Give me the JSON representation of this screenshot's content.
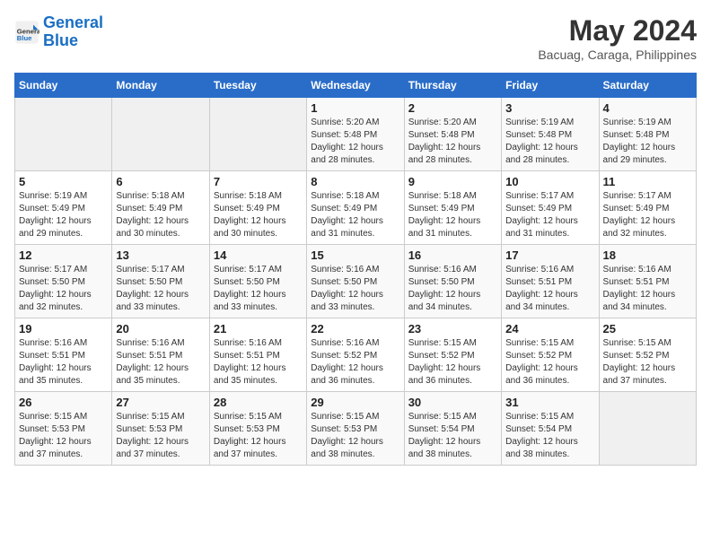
{
  "header": {
    "logo_line1": "General",
    "logo_line2": "Blue",
    "month": "May 2024",
    "location": "Bacuag, Caraga, Philippines"
  },
  "weekdays": [
    "Sunday",
    "Monday",
    "Tuesday",
    "Wednesday",
    "Thursday",
    "Friday",
    "Saturday"
  ],
  "weeks": [
    [
      {
        "day": "",
        "sunrise": "",
        "sunset": "",
        "daylight": ""
      },
      {
        "day": "",
        "sunrise": "",
        "sunset": "",
        "daylight": ""
      },
      {
        "day": "",
        "sunrise": "",
        "sunset": "",
        "daylight": ""
      },
      {
        "day": "1",
        "sunrise": "5:20 AM",
        "sunset": "5:48 PM",
        "daylight": "12 hours and 28 minutes."
      },
      {
        "day": "2",
        "sunrise": "5:20 AM",
        "sunset": "5:48 PM",
        "daylight": "12 hours and 28 minutes."
      },
      {
        "day": "3",
        "sunrise": "5:19 AM",
        "sunset": "5:48 PM",
        "daylight": "12 hours and 28 minutes."
      },
      {
        "day": "4",
        "sunrise": "5:19 AM",
        "sunset": "5:48 PM",
        "daylight": "12 hours and 29 minutes."
      }
    ],
    [
      {
        "day": "5",
        "sunrise": "5:19 AM",
        "sunset": "5:49 PM",
        "daylight": "12 hours and 29 minutes."
      },
      {
        "day": "6",
        "sunrise": "5:18 AM",
        "sunset": "5:49 PM",
        "daylight": "12 hours and 30 minutes."
      },
      {
        "day": "7",
        "sunrise": "5:18 AM",
        "sunset": "5:49 PM",
        "daylight": "12 hours and 30 minutes."
      },
      {
        "day": "8",
        "sunrise": "5:18 AM",
        "sunset": "5:49 PM",
        "daylight": "12 hours and 31 minutes."
      },
      {
        "day": "9",
        "sunrise": "5:18 AM",
        "sunset": "5:49 PM",
        "daylight": "12 hours and 31 minutes."
      },
      {
        "day": "10",
        "sunrise": "5:17 AM",
        "sunset": "5:49 PM",
        "daylight": "12 hours and 31 minutes."
      },
      {
        "day": "11",
        "sunrise": "5:17 AM",
        "sunset": "5:49 PM",
        "daylight": "12 hours and 32 minutes."
      }
    ],
    [
      {
        "day": "12",
        "sunrise": "5:17 AM",
        "sunset": "5:50 PM",
        "daylight": "12 hours and 32 minutes."
      },
      {
        "day": "13",
        "sunrise": "5:17 AM",
        "sunset": "5:50 PM",
        "daylight": "12 hours and 33 minutes."
      },
      {
        "day": "14",
        "sunrise": "5:17 AM",
        "sunset": "5:50 PM",
        "daylight": "12 hours and 33 minutes."
      },
      {
        "day": "15",
        "sunrise": "5:16 AM",
        "sunset": "5:50 PM",
        "daylight": "12 hours and 33 minutes."
      },
      {
        "day": "16",
        "sunrise": "5:16 AM",
        "sunset": "5:50 PM",
        "daylight": "12 hours and 34 minutes."
      },
      {
        "day": "17",
        "sunrise": "5:16 AM",
        "sunset": "5:51 PM",
        "daylight": "12 hours and 34 minutes."
      },
      {
        "day": "18",
        "sunrise": "5:16 AM",
        "sunset": "5:51 PM",
        "daylight": "12 hours and 34 minutes."
      }
    ],
    [
      {
        "day": "19",
        "sunrise": "5:16 AM",
        "sunset": "5:51 PM",
        "daylight": "12 hours and 35 minutes."
      },
      {
        "day": "20",
        "sunrise": "5:16 AM",
        "sunset": "5:51 PM",
        "daylight": "12 hours and 35 minutes."
      },
      {
        "day": "21",
        "sunrise": "5:16 AM",
        "sunset": "5:51 PM",
        "daylight": "12 hours and 35 minutes."
      },
      {
        "day": "22",
        "sunrise": "5:16 AM",
        "sunset": "5:52 PM",
        "daylight": "12 hours and 36 minutes."
      },
      {
        "day": "23",
        "sunrise": "5:15 AM",
        "sunset": "5:52 PM",
        "daylight": "12 hours and 36 minutes."
      },
      {
        "day": "24",
        "sunrise": "5:15 AM",
        "sunset": "5:52 PM",
        "daylight": "12 hours and 36 minutes."
      },
      {
        "day": "25",
        "sunrise": "5:15 AM",
        "sunset": "5:52 PM",
        "daylight": "12 hours and 37 minutes."
      }
    ],
    [
      {
        "day": "26",
        "sunrise": "5:15 AM",
        "sunset": "5:53 PM",
        "daylight": "12 hours and 37 minutes."
      },
      {
        "day": "27",
        "sunrise": "5:15 AM",
        "sunset": "5:53 PM",
        "daylight": "12 hours and 37 minutes."
      },
      {
        "day": "28",
        "sunrise": "5:15 AM",
        "sunset": "5:53 PM",
        "daylight": "12 hours and 37 minutes."
      },
      {
        "day": "29",
        "sunrise": "5:15 AM",
        "sunset": "5:53 PM",
        "daylight": "12 hours and 38 minutes."
      },
      {
        "day": "30",
        "sunrise": "5:15 AM",
        "sunset": "5:54 PM",
        "daylight": "12 hours and 38 minutes."
      },
      {
        "day": "31",
        "sunrise": "5:15 AM",
        "sunset": "5:54 PM",
        "daylight": "12 hours and 38 minutes."
      },
      {
        "day": "",
        "sunrise": "",
        "sunset": "",
        "daylight": ""
      }
    ]
  ]
}
